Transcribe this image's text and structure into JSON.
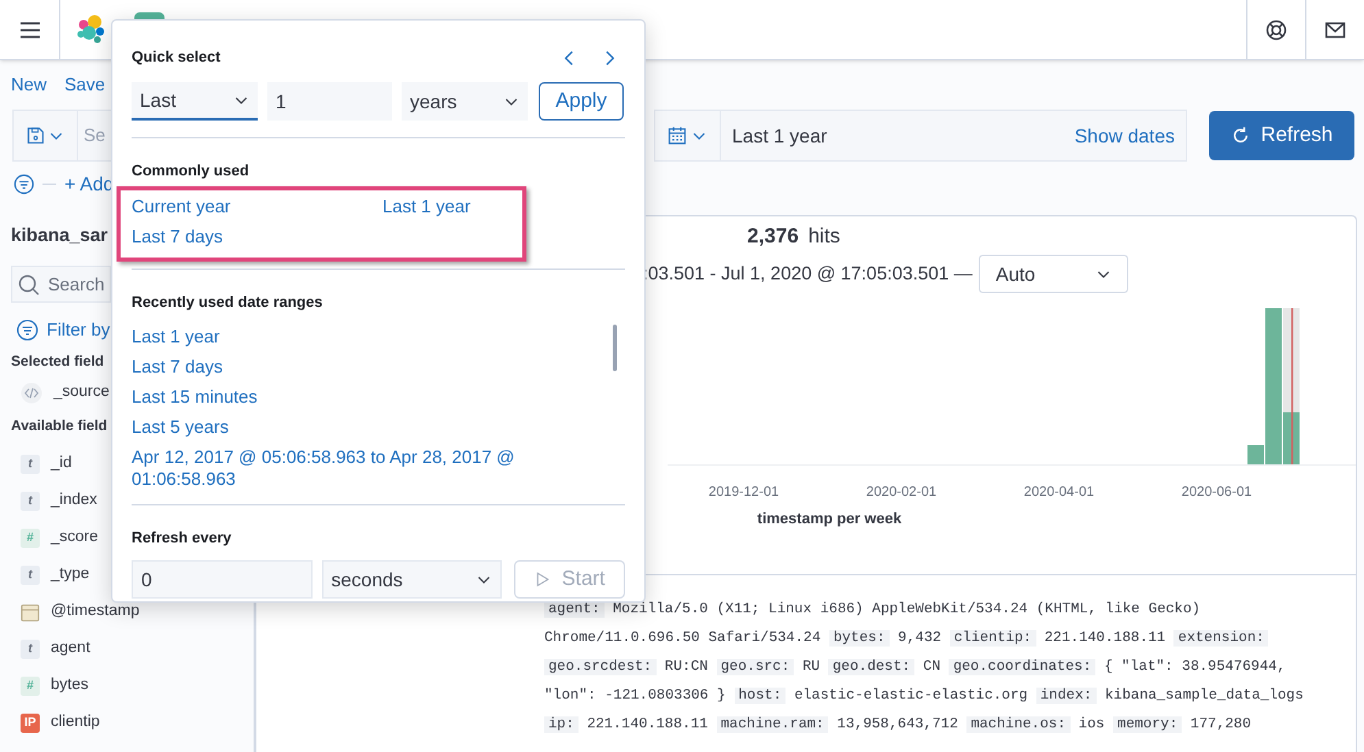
{
  "top_nav": [
    {
      "label": "New"
    },
    {
      "label": "Save"
    }
  ],
  "query_bar": {
    "placeholder": "Se",
    "add_filter": "+ Add"
  },
  "date_picker": {
    "value": "Last 1 year",
    "show_dates": "Show dates"
  },
  "refresh_button": "Refresh",
  "sidebar": {
    "index_pattern": "kibana_sar",
    "search_placeholder": "Search",
    "filter_label": "Filter by",
    "selected_heading": "Selected field",
    "selected_fields": [
      {
        "kind": "source",
        "name": "_source"
      }
    ],
    "available_heading": "Available field",
    "available_fields": [
      {
        "kind": "string",
        "badge": "t",
        "name": "_id"
      },
      {
        "kind": "string",
        "badge": "t",
        "name": "_index"
      },
      {
        "kind": "number",
        "badge": "#",
        "name": "_score"
      },
      {
        "kind": "string",
        "badge": "t",
        "name": "_type"
      },
      {
        "kind": "date",
        "name": "@timestamp"
      },
      {
        "kind": "string",
        "badge": "t",
        "name": "agent"
      },
      {
        "kind": "number",
        "badge": "#",
        "name": "bytes"
      },
      {
        "kind": "ip",
        "badge": "IP",
        "name": "clientip"
      }
    ]
  },
  "histogram": {
    "hits_count": "2,376",
    "hits_label": "hits",
    "range": ":03.501 - Jul 1, 2020 @ 17:05:03.501 —",
    "interval": "Auto",
    "x_ticks": [
      "2019-12-01",
      "2020-02-01",
      "2020-04-01",
      "2020-06-01"
    ],
    "x_title": "timestamp per week"
  },
  "document": {
    "fields": [
      {
        "key": "agent:",
        "value": "Mozilla/5.0 (X11; Linux i686) AppleWebKit/534.24 (KHTML, like Gecko) Chrome/11.0.696.50 Safari/534.24"
      },
      {
        "key": "bytes:",
        "value": "9,432"
      },
      {
        "key": "clientip:",
        "value": "221.140.188.11"
      },
      {
        "key": "extension:"
      },
      {
        "key": "geo.srcdest:",
        "value": "RU:CN"
      },
      {
        "key": "geo.src:",
        "value": "RU"
      },
      {
        "key": "geo.dest:",
        "value": "CN"
      },
      {
        "key": "geo.coordinates:",
        "value": "{ \"lat\": 38.95476944, \"lon\": -121.0803306 }"
      },
      {
        "key": "host:",
        "value": "elastic-elastic-elastic.org"
      },
      {
        "key": "index:",
        "value": "kibana_sample_data_logs"
      },
      {
        "key": "ip:",
        "value": "221.140.188.11"
      },
      {
        "key": "machine.ram:",
        "value": "13,958,643,712"
      },
      {
        "key": "machine.os:",
        "value": "ios"
      },
      {
        "key": "memory:",
        "value": "177,280"
      }
    ]
  },
  "quick_select": {
    "title": "Quick select",
    "direction": "Last",
    "count": "1",
    "unit": "years",
    "apply": "Apply",
    "commonly_used_title": "Commonly used",
    "commonly_used": [
      "Current year",
      "Last 1 year",
      "Last 7 days"
    ],
    "recent_title": "Recently used date ranges",
    "recent": [
      "Last 1 year",
      "Last 7 days",
      "Last 15 minutes",
      "Last 5 years",
      "Apr 12, 2017 @ 05:06:58.963 to Apr 28, 2017 @ 01:06:58.963"
    ],
    "refresh_title": "Refresh every",
    "refresh_value": "0",
    "refresh_unit": "seconds",
    "start": "Start",
    "start_disabled": true
  }
}
